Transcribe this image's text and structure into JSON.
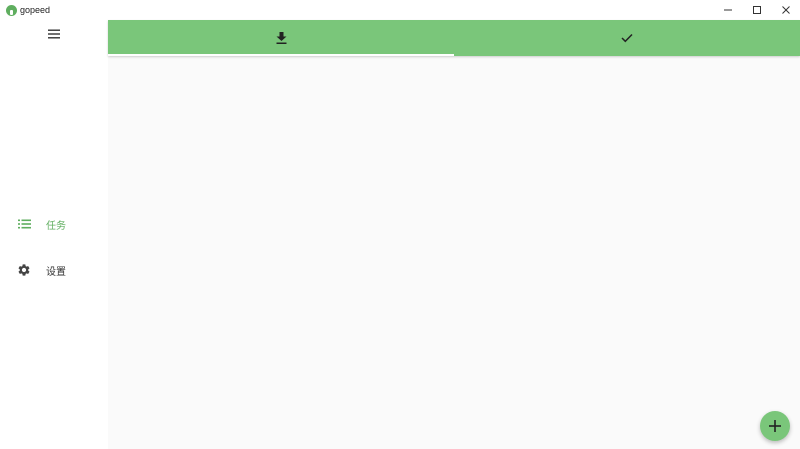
{
  "window": {
    "title": "gopeed",
    "controls": [
      {
        "name": "minimize",
        "glyph": "—"
      },
      {
        "name": "maximize",
        "glyph": "□"
      },
      {
        "name": "close",
        "glyph": "✕"
      }
    ]
  },
  "sidebar": {
    "menu_icon": "hamburger-menu-icon",
    "items": [
      {
        "label": "任务",
        "icon": "list-icon",
        "active": true
      },
      {
        "label": "设置",
        "icon": "gear-icon",
        "active": false
      }
    ]
  },
  "tabs": [
    {
      "icon": "download-icon",
      "active": true
    },
    {
      "icon": "check-icon",
      "active": false
    }
  ],
  "fab": {
    "icon": "add-icon"
  },
  "colors": {
    "accent": "#7ac67a",
    "active_text": "#5fae5f",
    "content_bg": "#fafafa"
  }
}
